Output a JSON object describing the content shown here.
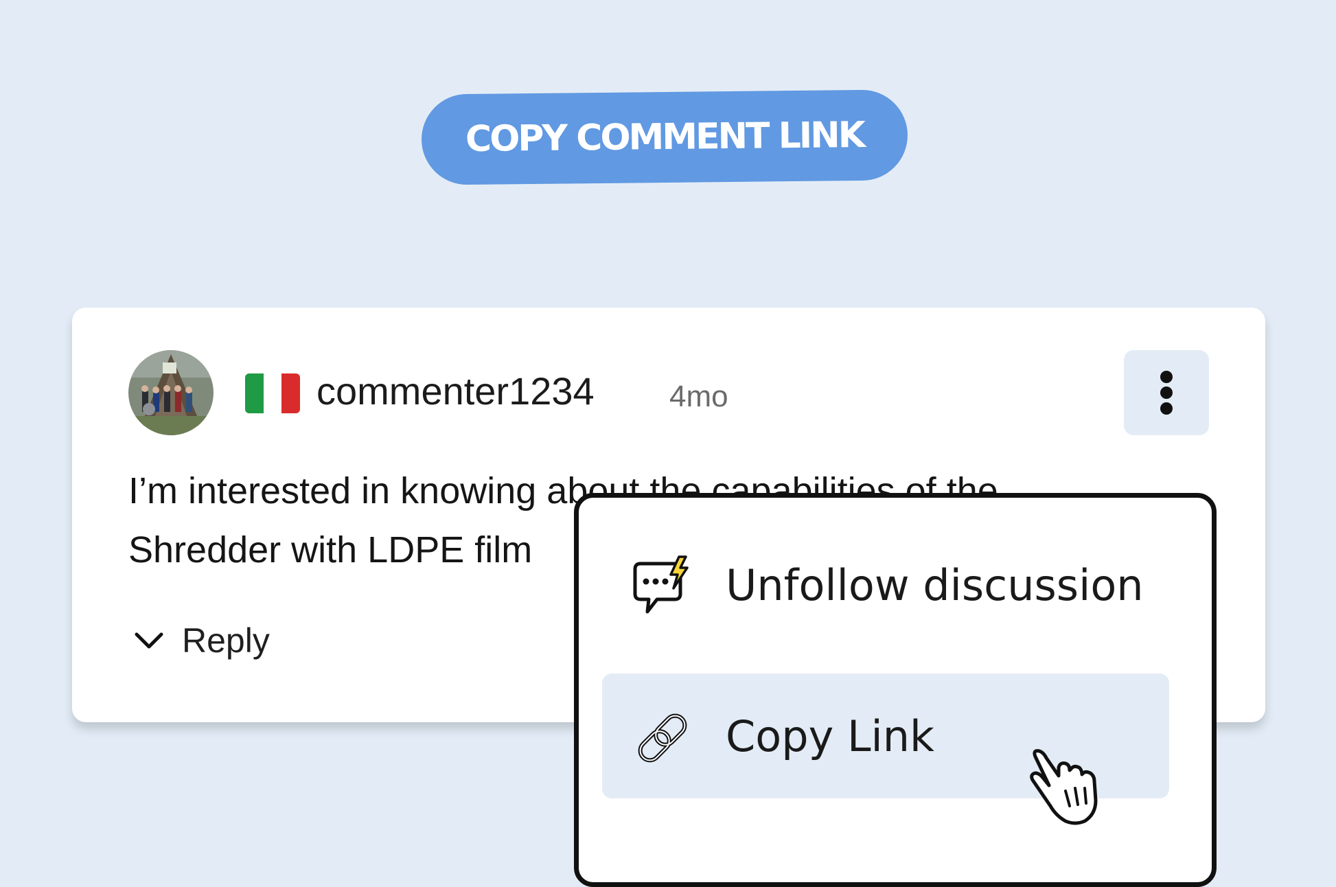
{
  "banner": {
    "text": "COPY COMMENT LINK"
  },
  "comment": {
    "avatar_icon": "user-photo-avatar",
    "flag": {
      "icon": "italy-flag-icon",
      "colors": [
        "#1f9a45",
        "#ffffff",
        "#d92b2b"
      ]
    },
    "username": "commenter1234",
    "timestamp": "4mo",
    "more_icon": "vertical-ellipsis-icon",
    "body_lines": [
      "I’m interested in knowing about the  capabilities of the",
      "Shredder with  LDPE film"
    ],
    "reply": {
      "icon": "chevron-down-icon",
      "label": "Reply"
    }
  },
  "menu": {
    "items": [
      {
        "label": "Unfollow discussion",
        "icon": "chat-bubble-lightning-icon",
        "highlighted": false
      },
      {
        "label": "Copy Link",
        "icon": "chain-link-icon",
        "highlighted": true
      }
    ]
  },
  "cursor_icon": "pointing-hand-cursor-icon",
  "colors": {
    "background": "#e3ecf6",
    "banner": "#6199e2",
    "card": "#ffffff",
    "highlight": "#e3ecf6",
    "lightning": "#f7d53a"
  }
}
